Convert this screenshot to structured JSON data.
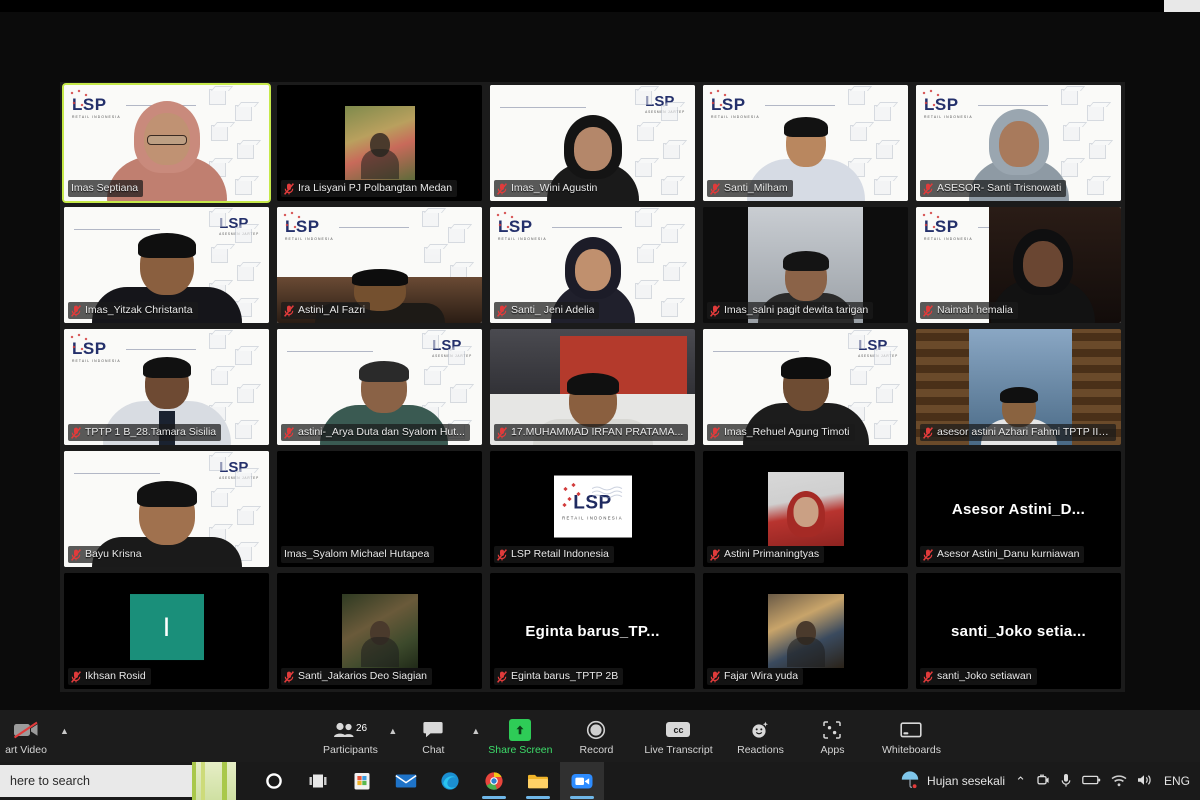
{
  "app": {
    "name": "Zoom Meeting",
    "view": "gallery-view"
  },
  "gallery": {
    "rows": 5,
    "cols": 5,
    "tiles": [
      {
        "name": "Imas Septiana",
        "muted": false,
        "active": true,
        "kind": "video-lsp-hijab",
        "bg": "white"
      },
      {
        "name": "Ira Lisyani PJ Polbangtan Medan",
        "muted": true,
        "active": false,
        "kind": "photo-outdoor",
        "bg": "black"
      },
      {
        "name": "Imas_Wini Agustin",
        "muted": true,
        "active": false,
        "kind": "video-lsp-hijab-dark",
        "bg": "white"
      },
      {
        "name": "Santi_Milham",
        "muted": true,
        "active": false,
        "kind": "video-lsp-man-shirt",
        "bg": "white"
      },
      {
        "name": "ASESOR- Santi Trisnowati",
        "muted": true,
        "active": false,
        "kind": "video-lsp-hijab-grey",
        "bg": "white"
      },
      {
        "name": "Imas_Yitzak Christanta",
        "muted": true,
        "active": false,
        "kind": "video-lsp-man",
        "bg": "white"
      },
      {
        "name": "Astini_Al Fazri",
        "muted": true,
        "active": false,
        "kind": "video-lsp-man-crop",
        "bg": "white"
      },
      {
        "name": "Santi_ Jeni Adelia",
        "muted": true,
        "active": false,
        "kind": "video-lsp-hijab-dark2",
        "bg": "white"
      },
      {
        "name": "Imas_salni pagit dewita tarigan",
        "muted": true,
        "active": false,
        "kind": "video-plain-room",
        "bg": "dark"
      },
      {
        "name": "Naimah hemalia",
        "muted": true,
        "active": false,
        "kind": "video-lsp-dark-hijab",
        "bg": "white"
      },
      {
        "name": "TPTP 1 B_28.Tamara Sisilia",
        "muted": true,
        "active": false,
        "kind": "video-lsp-uniform",
        "bg": "white"
      },
      {
        "name": "astini-_Arya Duta dan Syalom Hut...",
        "muted": true,
        "active": false,
        "kind": "video-lsp-two",
        "bg": "white"
      },
      {
        "name": "17.MUHAMMAD IRFAN PRATAMA...",
        "muted": true,
        "active": false,
        "kind": "video-room-man",
        "bg": "dark"
      },
      {
        "name": "Imas_Rehuel Agung Timoti",
        "muted": true,
        "active": false,
        "kind": "video-lsp-man2",
        "bg": "white"
      },
      {
        "name": "asesor astini Azhari Fahmi TPTP III B",
        "muted": true,
        "active": false,
        "kind": "video-indoor-man",
        "bg": "dark"
      },
      {
        "name": "Bayu Krisna",
        "muted": true,
        "active": false,
        "kind": "video-lsp-man3",
        "bg": "white"
      },
      {
        "name": "Imas_Syalom Michael Hutapea",
        "muted": false,
        "active": false,
        "kind": "blank",
        "bg": "black"
      },
      {
        "name": "LSP Retail Indonesia",
        "muted": true,
        "active": false,
        "kind": "logo-card",
        "bg": "black"
      },
      {
        "name": "Astini Primaningtyas",
        "muted": true,
        "active": false,
        "kind": "photo-hijab-red",
        "bg": "black"
      },
      {
        "name": "Asesor Astini_Danu kurniawan",
        "display_name": "Asesor  Astini_D...",
        "muted": true,
        "active": false,
        "kind": "text-name",
        "bg": "black"
      },
      {
        "name": "Ikhsan Rosid",
        "initial": "I",
        "muted": true,
        "active": false,
        "kind": "initial",
        "bg": "black"
      },
      {
        "name": "Santi_Jakarios Deo Siagian",
        "muted": true,
        "active": false,
        "kind": "photo-outdoor2",
        "bg": "black"
      },
      {
        "name": "Eginta barus_TPTP 2B",
        "display_name": "Eginta  barus_TP...",
        "muted": true,
        "active": false,
        "kind": "text-name",
        "bg": "black"
      },
      {
        "name": "Fajar Wira yuda",
        "muted": true,
        "active": false,
        "kind": "photo-indoor3",
        "bg": "black"
      },
      {
        "name": "santi_Joko setiawan",
        "display_name": "santi_Joko  setia...",
        "muted": true,
        "active": false,
        "kind": "text-name",
        "bg": "black"
      }
    ],
    "virtual_background": {
      "brand": "LSP",
      "brand_sub": "RETAIL INDONESIA",
      "brand_sub_alt": "ASESMEN JARTEP"
    },
    "active_speaker_border_color": "#c6e94a"
  },
  "toolbar": {
    "video": {
      "label": "art Video",
      "full_label": "Start Video",
      "muted": true
    },
    "participants": {
      "label": "Participants",
      "count": "26"
    },
    "chat": {
      "label": "Chat"
    },
    "share_screen": {
      "label": "Share Screen",
      "color": "#3ddc6a"
    },
    "record": {
      "label": "Record"
    },
    "live_transcript": {
      "label": "Live Transcript",
      "icon_text": "cc"
    },
    "reactions": {
      "label": "Reactions"
    },
    "apps": {
      "label": "Apps"
    },
    "whiteboards": {
      "label": "Whiteboards"
    }
  },
  "taskbar": {
    "search_text": "here to search",
    "search_full": "Type here to search",
    "weather": "Hujan sesekali",
    "language": "ENG",
    "apps": [
      {
        "name": "cortana-icon"
      },
      {
        "name": "task-view-icon"
      },
      {
        "name": "microsoft-store-icon"
      },
      {
        "name": "mail-icon"
      },
      {
        "name": "microsoft-edge-icon"
      },
      {
        "name": "google-chrome-icon"
      },
      {
        "name": "file-explorer-icon"
      },
      {
        "name": "zoom-icon"
      }
    ]
  }
}
